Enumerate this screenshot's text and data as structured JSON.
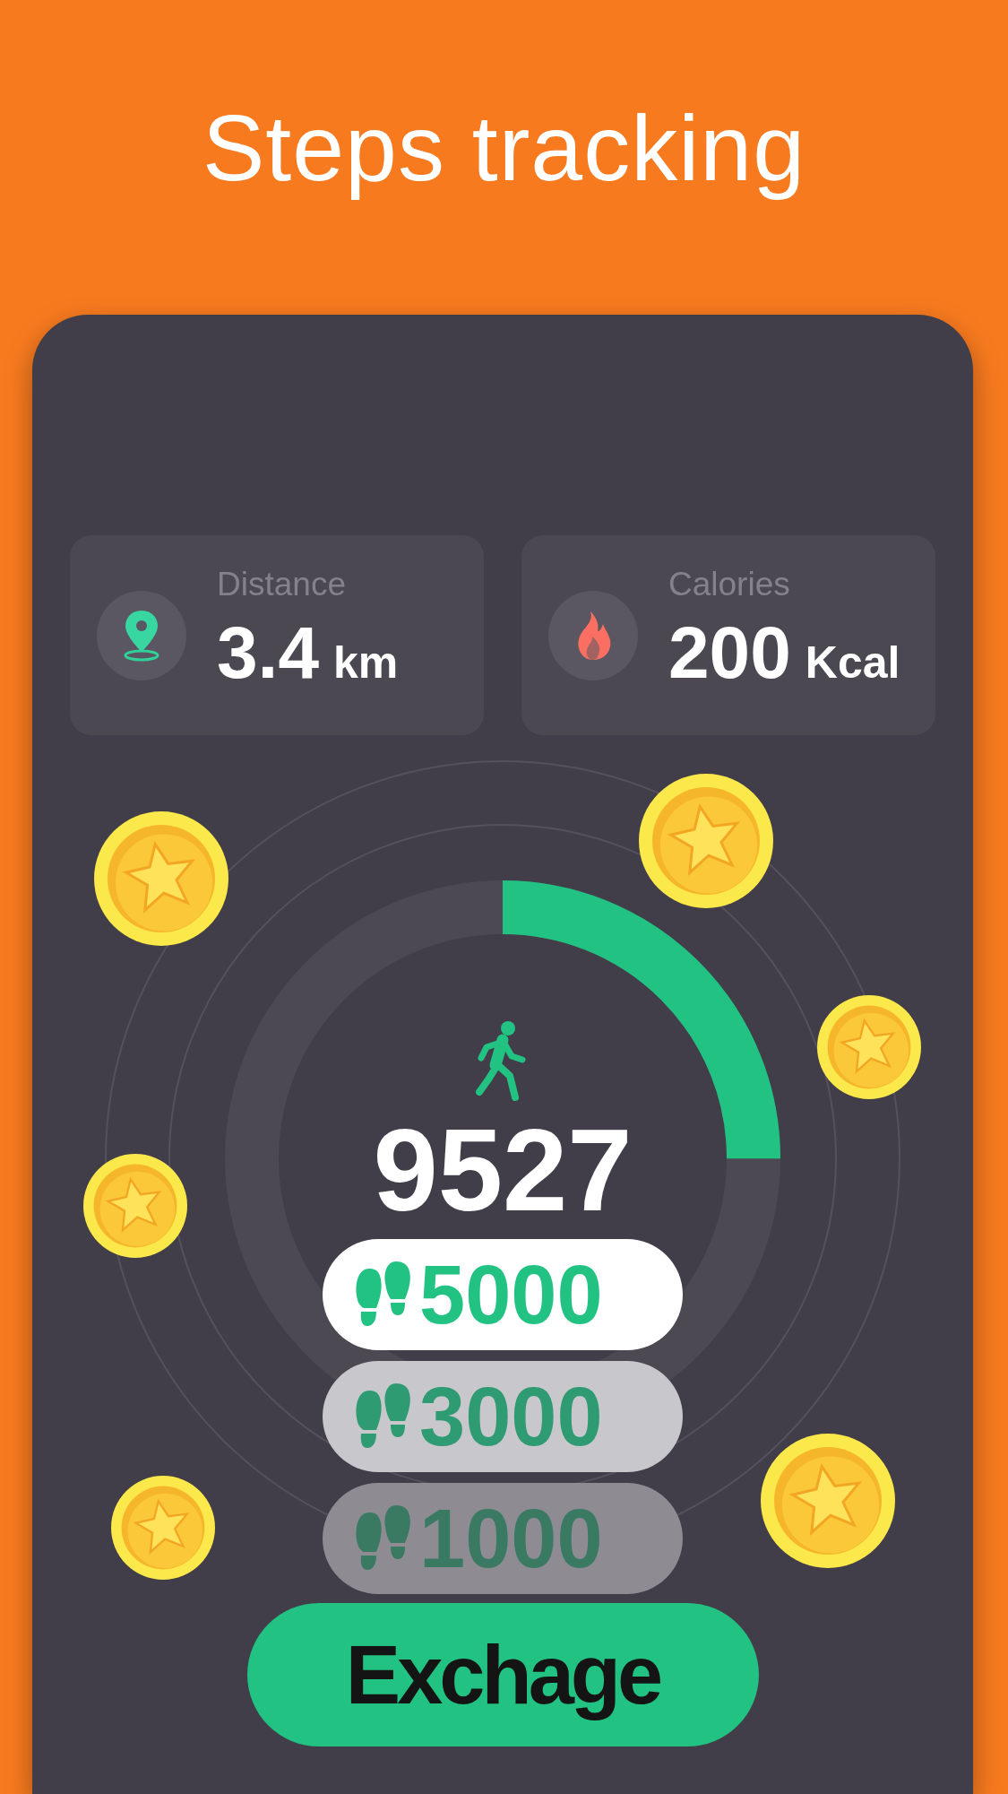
{
  "title": "Steps tracking",
  "stats": [
    {
      "kind": "distance",
      "label": "Distance",
      "value": "3.4",
      "unit": "km"
    },
    {
      "kind": "calories",
      "label": "Calories",
      "value": "200",
      "unit": "Kcal"
    }
  ],
  "progress": {
    "level": 0.25,
    "steps": "9527"
  },
  "rewards": [
    {
      "amount": "5000",
      "selected": true
    },
    {
      "amount": "3000",
      "selected": false
    },
    {
      "amount": "1000",
      "selected": false
    }
  ],
  "button": "Exchage"
}
